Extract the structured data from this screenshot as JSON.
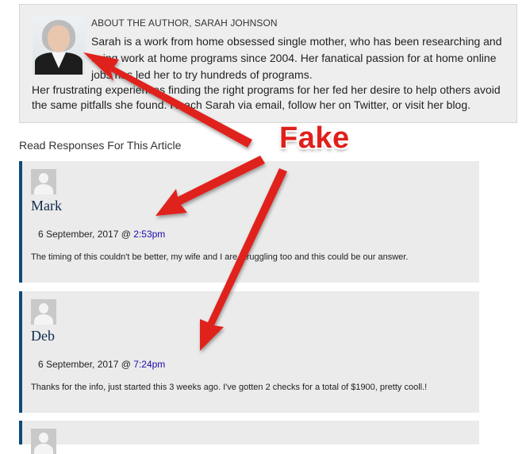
{
  "author": {
    "heading": "ABOUT THE AUTHOR, SARAH JOHNSON",
    "bio_line1": "Sarah is a work from home obsessed single mother, who has been researching and using work at home programs since 2004. Her fanatical passion for at home online jobs has led her to try hundreds of programs.",
    "bio_line2": "Her frustrating experiences finding the right programs for her fed her desire to help others avoid the same pitfalls she found. Reach Sarah via email, follow her on Twitter, or visit her blog."
  },
  "responses": {
    "heading": "Read Responses For This Article",
    "comments": [
      {
        "name": "Mark",
        "date": "6 September, 2017 @ ",
        "time": "2:53pm",
        "text": "The timing of this couldn't be better, my wife and I are struggling too and this could be our answer."
      },
      {
        "name": "Deb",
        "date": "6 September, 2017 @ ",
        "time": "7:24pm",
        "text": "Thanks for the info, just started this 3 weeks ago. I've gotten 2 checks for a total of $1900, pretty cooll.!"
      }
    ]
  },
  "annotation": {
    "label": "Fake",
    "color": "#e0201b"
  }
}
